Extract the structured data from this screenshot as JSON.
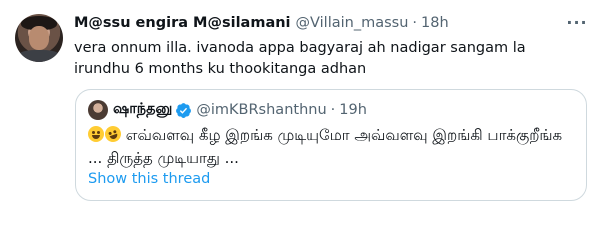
{
  "tweet": {
    "display_name": "M@ssu engira M@silamani",
    "handle": "@Villain_massu",
    "separator": "·",
    "time": "18h",
    "more_label": "···",
    "text": "vera  onnum illa. ivanoda appa bagyaraj ah nadigar sangam la irundhu 6 months ku thookitanga adhan",
    "avatar_icon": "user-avatar-icon"
  },
  "quoted": {
    "display_name": "ஷாந்தனு",
    "verified_icon": "verified-badge-icon",
    "verified_color": "#1d9bf0",
    "handle": "@imKBRshanthnu",
    "separator": "·",
    "time": "19h",
    "emojis": [
      "face-with-tears-of-joy",
      "rolling-on-the-floor-laughing"
    ],
    "text": "எவ்வளவு கீழ இறங்க முடியுமோ அவ்வளவு இறங்கி பாக்குறீங்க ... திருத்த முடியாது ...",
    "show_thread_label": "Show this thread",
    "link_color": "#1d9bf0"
  }
}
